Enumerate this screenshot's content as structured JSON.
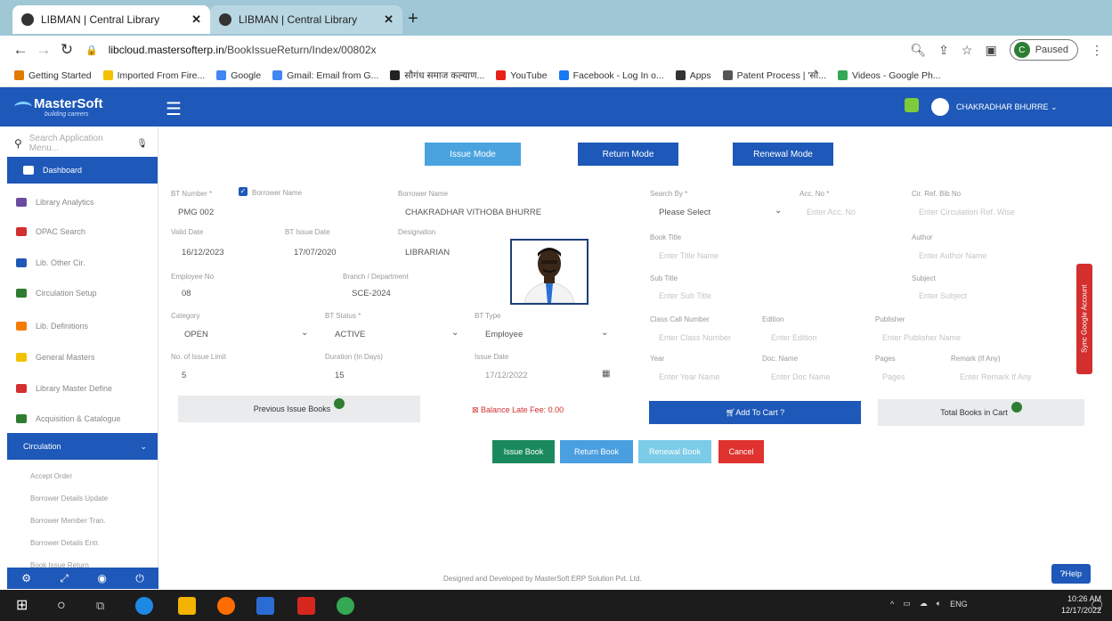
{
  "browser": {
    "tabs": [
      {
        "title": "LIBMAN | Central Library"
      },
      {
        "title": "LIBMAN | Central Library"
      }
    ],
    "new_tab": "+",
    "url_host": "libcloud.mastersofterp.in",
    "url_path": "/BookIssueReturn/Index/00802x",
    "profile_label": "Paused",
    "profile_initial": "C",
    "bookmarks": [
      {
        "label": "Getting Started",
        "color": "#e07b00"
      },
      {
        "label": "Imported From Fire...",
        "color": "#f2c200"
      },
      {
        "label": "Google",
        "color": "#4285f4"
      },
      {
        "label": "Gmail: Email from G...",
        "color": "#4285f4"
      },
      {
        "label": "सौगंध समाज कल्याण...",
        "color": "#222222"
      },
      {
        "label": "YouTube",
        "color": "#e62117"
      },
      {
        "label": "Facebook - Log In o...",
        "color": "#1877f2"
      },
      {
        "label": "Apps",
        "color": "#333333"
      },
      {
        "label": "Patent Process | 'सौ...",
        "color": "#555555"
      },
      {
        "label": "Videos - Google Ph...",
        "color": "#34a853"
      }
    ]
  },
  "app": {
    "logo": "MasterSoft",
    "logo_tagline": "building careers",
    "user_name": "CHAKRADHAR BHURRE ⌄"
  },
  "sidebar": {
    "search_placeholder": "Search Application Menu...",
    "items": [
      {
        "label": "Dashboard",
        "color": "#ffffff",
        "active": true
      },
      {
        "label": "Library Analytics",
        "color": "#6a4ca0"
      },
      {
        "label": "OPAC Search",
        "color": "#d32f2f"
      },
      {
        "label": "Lib. Other Cir.",
        "color": "#1e58b8"
      },
      {
        "label": "Circulation Setup",
        "color": "#2e7d32"
      },
      {
        "label": "Lib. Definitions",
        "color": "#f57c00"
      },
      {
        "label": "General Masters",
        "color": "#f2c200"
      },
      {
        "label": "Library Master Define",
        "color": "#d32f2f"
      },
      {
        "label": "Acquisition & Catalogue",
        "color": "#2e7d32"
      }
    ],
    "circulation": "Circulation",
    "sub_items": [
      "Accept Order",
      "Borrower Details Update",
      "Borrower Member Tran.",
      "Borrower Details Entr.",
      "Book Issue Return"
    ]
  },
  "modes": {
    "issue": "Issue Mode",
    "return": "Return Mode",
    "renewal": "Renewal Mode"
  },
  "form": {
    "bt_number_label": "BT Number *",
    "borrower_name_cb": "Borrower Name",
    "bt_number_value": "PMG 002",
    "borrower_name_label": "Borrower Name",
    "borrower_name_value": "CHAKRADHAR VITHOBA BHURRE",
    "valid_date_label": "Valid Date",
    "valid_date_value": "16/12/2023",
    "bt_issue_date_label": "BT Issue Date",
    "bt_issue_date_value": "17/07/2020",
    "designation_label": "Designation",
    "designation_value": "LIBRARIAN",
    "employee_no_label": "Employee No",
    "employee_no_value": "08",
    "branch_label": "Branch / Department",
    "branch_value": "SCE-2024",
    "category_label": "Category",
    "category_value": "OPEN",
    "bt_status_label": "BT Status *",
    "bt_status_value": "ACTIVE",
    "bt_type_label": "BT Type",
    "bt_type_value": "Employee",
    "no_of_issue_label": "No. of Issue Limit",
    "no_of_issue_value": "5",
    "duration_label": "Duration (In Days)",
    "duration_value": "15",
    "issue_date_label": "Issue Date",
    "issue_date_value": "17/12/2022",
    "search_by_label": "Search By *",
    "search_by_value": "Please Select",
    "acc_no_label": "Acc. No *",
    "acc_no_ph": "Enter Acc. No",
    "ref_label": "Cir. Ref. Bib No",
    "ref_ph": "Enter Circulation Ref. Wise",
    "book_title_label": "Book Title",
    "book_title_ph": "Enter Title Name",
    "author_label": "Author",
    "author_ph": "Enter Author Name",
    "sub_title_label": "Sub Title",
    "sub_title_ph": "Enter Sub Title",
    "subject_label": "Subject",
    "subject_ph": "Enter Subject",
    "class_label": "Class Call Number",
    "class_ph": "Enter Class Number",
    "edition_label": "Edition",
    "edition_ph": "Enter Edition",
    "publisher_label": "Publisher",
    "publisher_ph": "Enter Publisher Name",
    "year_label": "Year",
    "year_ph": "Enter Year Name",
    "doc_label": "Doc. Name",
    "doc_ph": "Enter Doc Name",
    "pages_label": "Pages",
    "pages_ph": "Pages",
    "remark_label": "Remark (If Any)",
    "remark_ph": "Enter Remark If Any"
  },
  "cart": {
    "previous_issue": "Previous Issue Books",
    "late_fee": "Balance Late Fee: 0.00",
    "add_to_cart": "Add To Cart ?",
    "total_books": "Total Books in Cart"
  },
  "actions": {
    "issue": "Issue Book",
    "return": "Return Book",
    "renewal": "Renewal Book",
    "cancel": "Cancel"
  },
  "footer": "Designed and Developed by MasterSoft ERP Solution Pvt. Ltd.",
  "help": "Help",
  "sync": "Sync Google Account",
  "taskbar": {
    "lang": "ENG",
    "time": "10:26 AM",
    "date": "12/17/2022"
  }
}
